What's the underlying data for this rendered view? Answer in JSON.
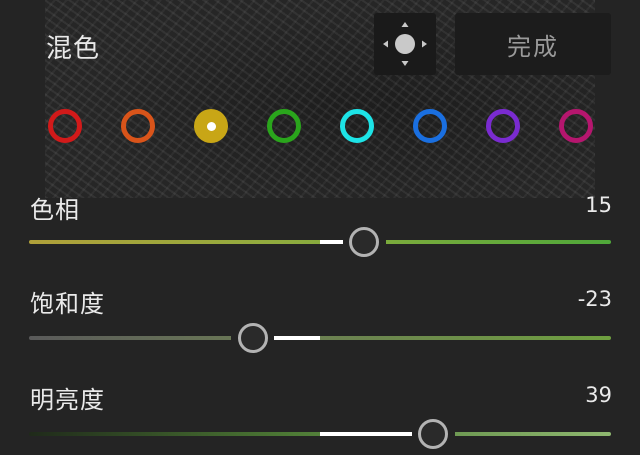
{
  "panel": {
    "title": "混色",
    "done_label": "完成"
  },
  "target_tool": {
    "icon": "targeted-adjustment-icon"
  },
  "colors": {
    "swatches": [
      {
        "name": "red",
        "color": "#d21a1a",
        "selected": false
      },
      {
        "name": "orange",
        "color": "#d9541a",
        "selected": false
      },
      {
        "name": "yellow",
        "color": "#c8a616",
        "selected": true
      },
      {
        "name": "green",
        "color": "#2aa51c",
        "selected": false
      },
      {
        "name": "aqua",
        "color": "#1de3e6",
        "selected": false
      },
      {
        "name": "blue",
        "color": "#1a6fe0",
        "selected": false
      },
      {
        "name": "purple",
        "color": "#7a2bd0",
        "selected": false
      },
      {
        "name": "magenta",
        "color": "#b5166e",
        "selected": false
      }
    ]
  },
  "sliders": {
    "hue": {
      "label": "色相",
      "value": "15",
      "number": 15,
      "min": -100,
      "max": 100
    },
    "saturation": {
      "label": "饱和度",
      "value": "-23",
      "number": -23,
      "min": -100,
      "max": 100
    },
    "luminance": {
      "label": "明亮度",
      "value": "39",
      "number": 39,
      "min": -100,
      "max": 100
    }
  }
}
